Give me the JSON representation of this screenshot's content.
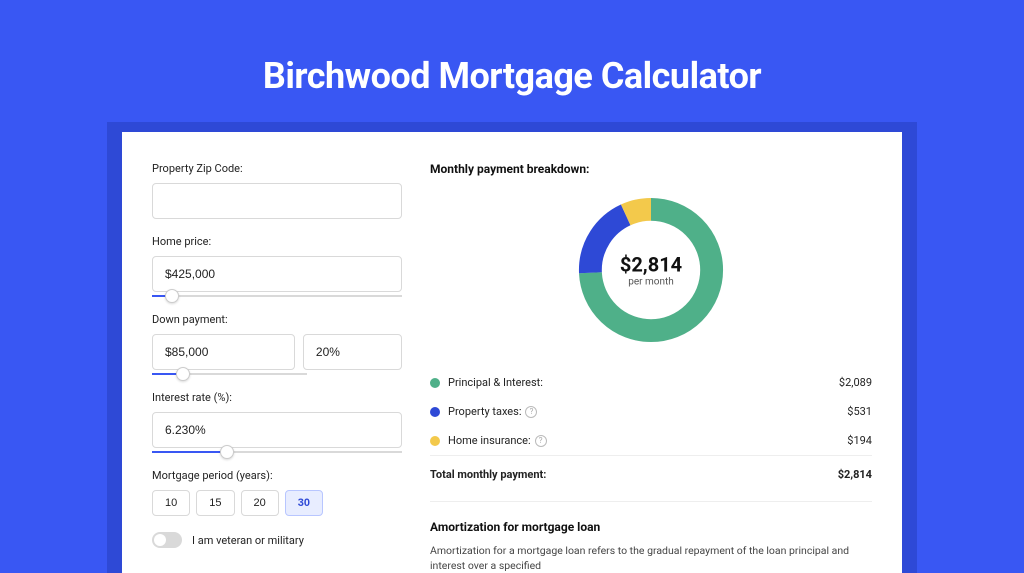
{
  "hero": {
    "title": "Birchwood Mortgage Calculator"
  },
  "form": {
    "zip": {
      "label": "Property Zip Code:",
      "value": ""
    },
    "home_price": {
      "label": "Home price:",
      "value": "$425,000",
      "slider_pct": 8
    },
    "down_payment": {
      "label": "Down payment:",
      "amount": "$85,000",
      "percent": "20%",
      "slider_pct": 20
    },
    "interest": {
      "label": "Interest rate (%):",
      "value": "6.230%",
      "slider_pct": 30
    },
    "period": {
      "label": "Mortgage period (years):",
      "options": [
        "10",
        "15",
        "20",
        "30"
      ],
      "active_index": 3
    },
    "veteran": {
      "label": "I am veteran or military",
      "on": false
    }
  },
  "breakdown": {
    "title": "Monthly payment breakdown:",
    "donut_amount": "$2,814",
    "donut_sub": "per month",
    "items": [
      {
        "label": "Principal & Interest:",
        "value": "$2,089",
        "color": "#4fb089",
        "has_info": false
      },
      {
        "label": "Property taxes:",
        "value": "$531",
        "color": "#2e49d6",
        "has_info": true
      },
      {
        "label": "Home insurance:",
        "value": "$194",
        "color": "#f3c94b",
        "has_info": true
      }
    ],
    "total": {
      "label": "Total monthly payment:",
      "value": "$2,814"
    }
  },
  "amort": {
    "title": "Amortization for mortgage loan",
    "text": "Amortization for a mortgage loan refers to the gradual repayment of the loan principal and interest over a specified"
  },
  "chart_data": {
    "type": "pie",
    "title": "Monthly payment breakdown",
    "total_label": "$2,814 per month",
    "series": [
      {
        "name": "Principal & Interest",
        "value": 2089,
        "color": "#4fb089"
      },
      {
        "name": "Property taxes",
        "value": 531,
        "color": "#2e49d6"
      },
      {
        "name": "Home insurance",
        "value": 194,
        "color": "#f3c94b"
      }
    ]
  }
}
